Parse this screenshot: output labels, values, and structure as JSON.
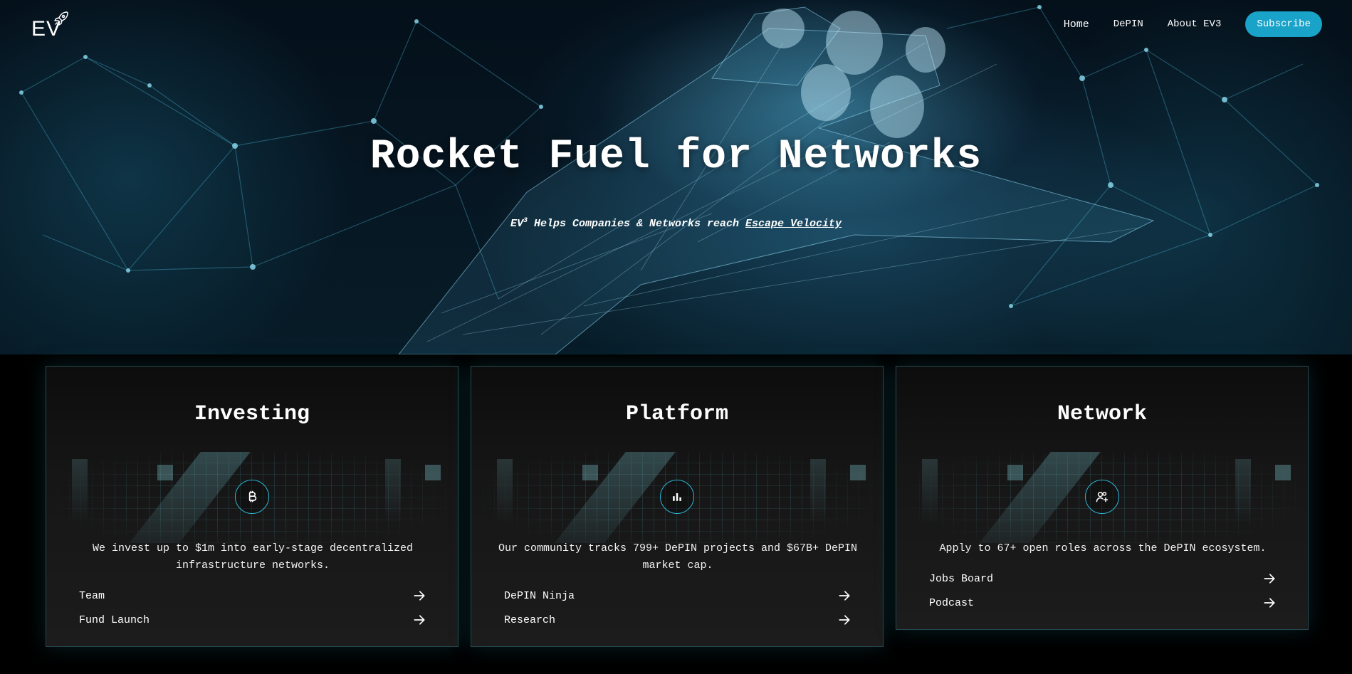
{
  "brand": {
    "logo_text": "EV",
    "logo_icon": "rocket-icon"
  },
  "nav": {
    "links": [
      {
        "label": "Home"
      },
      {
        "label": "DePIN"
      },
      {
        "label": "About EV3"
      }
    ],
    "subscribe_label": "Subscribe"
  },
  "hero": {
    "title": "Rocket Fuel for Networks",
    "subtitle_prefix": "EV",
    "subtitle_sup": "3",
    "subtitle_middle": " Helps Companies & Networks reach ",
    "subtitle_link": "Escape Velocity"
  },
  "cards": [
    {
      "title": "Investing",
      "icon": "bitcoin-icon",
      "description": "We invest up to $1m into early-stage decentralized infrastructure networks.",
      "links": [
        {
          "label": "Team"
        },
        {
          "label": "Fund Launch"
        }
      ]
    },
    {
      "title": "Platform",
      "icon": "bar-chart-icon",
      "description": "Our community tracks 799+ DePIN projects and $67B+ DePIN market cap.",
      "links": [
        {
          "label": "DePIN Ninja"
        },
        {
          "label": "Research"
        }
      ]
    },
    {
      "title": "Network",
      "icon": "user-plus-icon",
      "description": "Apply to 67+ open roles across the DePIN ecosystem.",
      "links": [
        {
          "label": "Jobs Board"
        },
        {
          "label": "Podcast"
        }
      ]
    }
  ],
  "colors": {
    "accent": "#1aa3c9",
    "icon_ring": "#2fb6d8",
    "card_border": "#25494f",
    "background": "#000000"
  }
}
